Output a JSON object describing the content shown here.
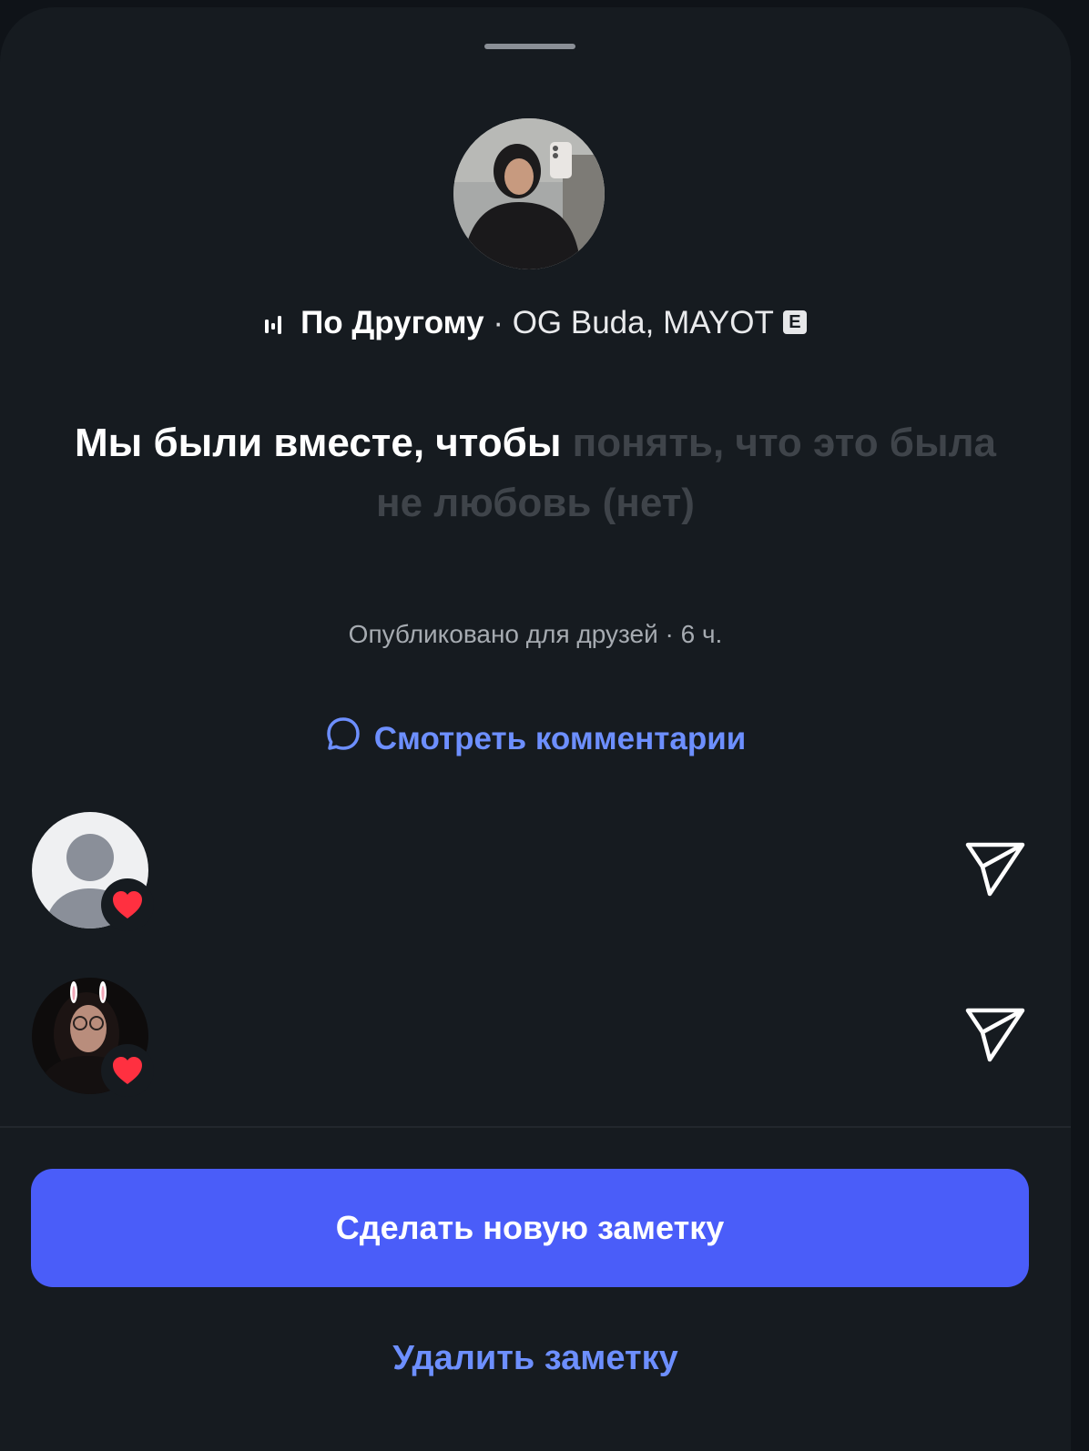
{
  "app": {
    "accent_color": "#4a5df9",
    "link_color": "#6d8fff"
  },
  "note": {
    "song": {
      "icon": "music-bars-icon",
      "title": "По Другому",
      "separator": "·",
      "artists": "OG Buda, MAYOT",
      "explicit_badge": "E"
    },
    "lyrics": {
      "sung": "Мы были вместе, чтобы",
      "unsung": "понять, что это была не любовь (нет)"
    },
    "published": "Опубликовано для друзей · 6 ч.",
    "view_comments_label": "Смотреть комментарии"
  },
  "reactions": [
    {
      "avatar": "default-avatar",
      "reaction_icon": "heart-icon",
      "action_icon": "send-icon"
    },
    {
      "avatar": "photo-avatar",
      "reaction_icon": "heart-icon",
      "action_icon": "send-icon"
    }
  ],
  "actions": {
    "new_note_label": "Сделать новую заметку",
    "delete_note_label": "Удалить заметку"
  }
}
